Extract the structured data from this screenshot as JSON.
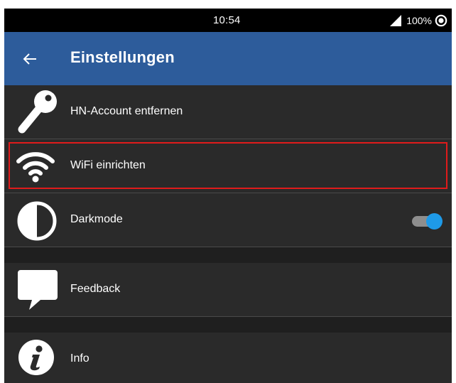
{
  "status_bar": {
    "time": "10:54",
    "battery": "100%",
    "icons": [
      "cell-signal-icon",
      "record-circle-icon"
    ]
  },
  "app_bar": {
    "title": "Einstellungen",
    "back_icon": "arrow-left-icon",
    "color": "#2d5c9b"
  },
  "settings": {
    "items": [
      {
        "label": "HN-Account entfernen",
        "icon": "key-icon"
      },
      {
        "label": "WiFi einrichten",
        "icon": "wifi-icon",
        "highlighted": true
      },
      {
        "label": "Darkmode",
        "icon": "contrast-icon",
        "toggle": true,
        "toggle_on": true
      },
      {
        "label": "Feedback",
        "icon": "speech-bubble-icon"
      },
      {
        "label": "Info",
        "icon": "info-icon"
      }
    ]
  },
  "colors": {
    "background": "#2a2a2a",
    "highlight": "#e01b1b",
    "toggle_thumb": "#1e9ae8"
  }
}
